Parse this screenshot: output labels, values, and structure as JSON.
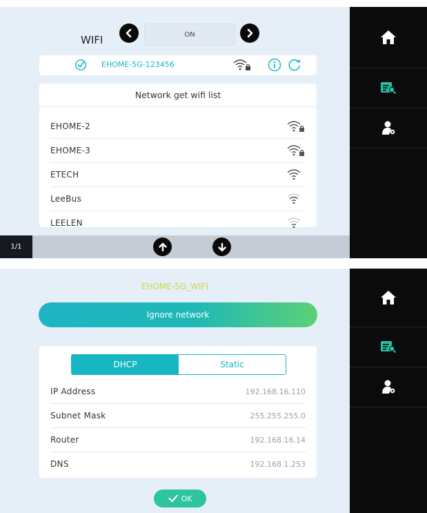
{
  "screen1": {
    "wifi_label": "WIFI",
    "wifi_state": "ON",
    "connected_ssid": "EHOME-5G-123456",
    "list_title": "Network get wifi list",
    "networks": [
      {
        "name": "EHOME-2",
        "locked": true,
        "signal": 4
      },
      {
        "name": "EHOME-3",
        "locked": true,
        "signal": 4
      },
      {
        "name": "ETECH",
        "locked": false,
        "signal": 4
      },
      {
        "name": "LeeBus",
        "locked": false,
        "signal": 3
      },
      {
        "name": "LEELEN",
        "locked": false,
        "signal": 2
      }
    ],
    "page_indicator": "1/1"
  },
  "screen2": {
    "network_name": "EHOME-5G_WIFI",
    "ignore_label": "Ignore network",
    "tab_dhcp": "DHCP",
    "tab_static": "Static",
    "fields": [
      {
        "label": "IP Address",
        "value": "192.168.16.110"
      },
      {
        "label": "Subnet Mask",
        "value": "255.255.255.0"
      },
      {
        "label": "Router",
        "value": "192.168.16.14"
      },
      {
        "label": "DNS",
        "value": "192.168.1.253"
      }
    ],
    "ok_label": "OK"
  },
  "sidebar_items": [
    {
      "icon": "home-icon"
    },
    {
      "icon": "network-settings-icon"
    },
    {
      "icon": "user-settings-icon"
    }
  ],
  "colors": {
    "accent": "#16b6c2",
    "green_button": "#2ec4a0",
    "network_name": "#c7d84a",
    "screen_bg": "#e6eef7",
    "sidebar_bg": "#0b0b0b"
  }
}
